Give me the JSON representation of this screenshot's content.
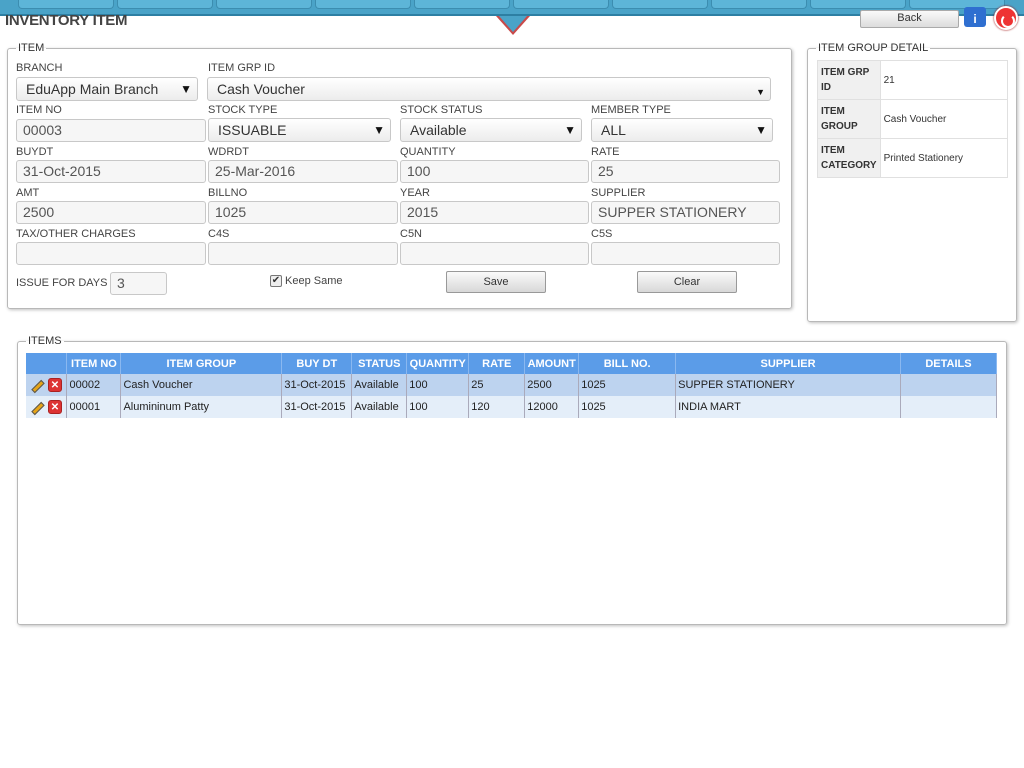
{
  "page": {
    "title": "INVENTORY ITEM"
  },
  "header": {
    "back_label": "Back",
    "info_label": "i"
  },
  "item_section": {
    "legend": "ITEM",
    "fields": {
      "branch": {
        "label": "BRANCH",
        "value": "EduApp Main Branch"
      },
      "item_grp_id": {
        "label": "ITEM GRP ID",
        "value": "Cash Voucher"
      },
      "item_no": {
        "label": "ITEM NO",
        "value": "00003"
      },
      "stock_type": {
        "label": "STOCK TYPE",
        "value": "ISSUABLE"
      },
      "stock_status": {
        "label": "STOCK STATUS",
        "value": "Available"
      },
      "member_type": {
        "label": "MEMBER TYPE",
        "value": "ALL"
      },
      "buydt": {
        "label": "BUYDT",
        "value": "31-Oct-2015"
      },
      "wdrdt": {
        "label": "WDRDT",
        "value": "25-Mar-2016"
      },
      "quantity": {
        "label": "QUANTITY",
        "value": "100"
      },
      "rate": {
        "label": "RATE",
        "value": "25"
      },
      "amt": {
        "label": "AMT",
        "value": "2500"
      },
      "billno": {
        "label": "BILLNO",
        "value": "1025"
      },
      "year": {
        "label": "YEAR",
        "value": "2015"
      },
      "supplier": {
        "label": "SUPPLIER",
        "value": "SUPPER STATIONERY"
      },
      "tax": {
        "label": "TAX/OTHER CHARGES",
        "value": ""
      },
      "c4s": {
        "label": "C4S",
        "value": ""
      },
      "c5n": {
        "label": "C5N",
        "value": ""
      },
      "c5s": {
        "label": "C5S",
        "value": ""
      },
      "issue_days": {
        "label": "ISSUE FOR DAYS",
        "value": "3"
      }
    },
    "keep_same_label": "Keep Same",
    "keep_same_checked": true,
    "save_label": "Save",
    "clear_label": "Clear"
  },
  "group_detail": {
    "legend": "ITEM GROUP DETAIL",
    "rows": [
      {
        "key_line1": "ITEM GRP",
        "key_line2": "ID",
        "value": "21"
      },
      {
        "key_line1": "ITEM",
        "key_line2": "GROUP",
        "value": "Cash Voucher"
      },
      {
        "key_line1": "ITEM",
        "key_line2": "CATEGORY",
        "value": "Printed Stationery"
      }
    ]
  },
  "items": {
    "legend": "ITEMS",
    "columns": [
      "",
      "ITEM NO",
      "ITEM GROUP",
      "BUY DT",
      "STATUS",
      "QUANTITY",
      "RATE",
      "AMOUNT",
      "BILL NO.",
      "SUPPLIER",
      "DETAILS"
    ],
    "rows": [
      {
        "item_no": "00002",
        "item_group": "Cash Voucher",
        "buy_dt": "31-Oct-2015",
        "status": "Available",
        "quantity": "100",
        "rate": "25",
        "amount": "2500",
        "bill_no": "1025",
        "supplier": "SUPPER STATIONERY",
        "details": ""
      },
      {
        "item_no": "00001",
        "item_group": "Alumininum Patty",
        "buy_dt": "31-Oct-2015",
        "status": "Available",
        "quantity": "100",
        "rate": "120",
        "amount": "12000",
        "bill_no": "1025",
        "supplier": "INDIA MART",
        "details": ""
      }
    ]
  },
  "colors": {
    "nav": "#4aa3c8",
    "grid_header": "#5b9ce8",
    "row_selected": "#bdd3ef",
    "row_alt": "#e4eef9"
  }
}
